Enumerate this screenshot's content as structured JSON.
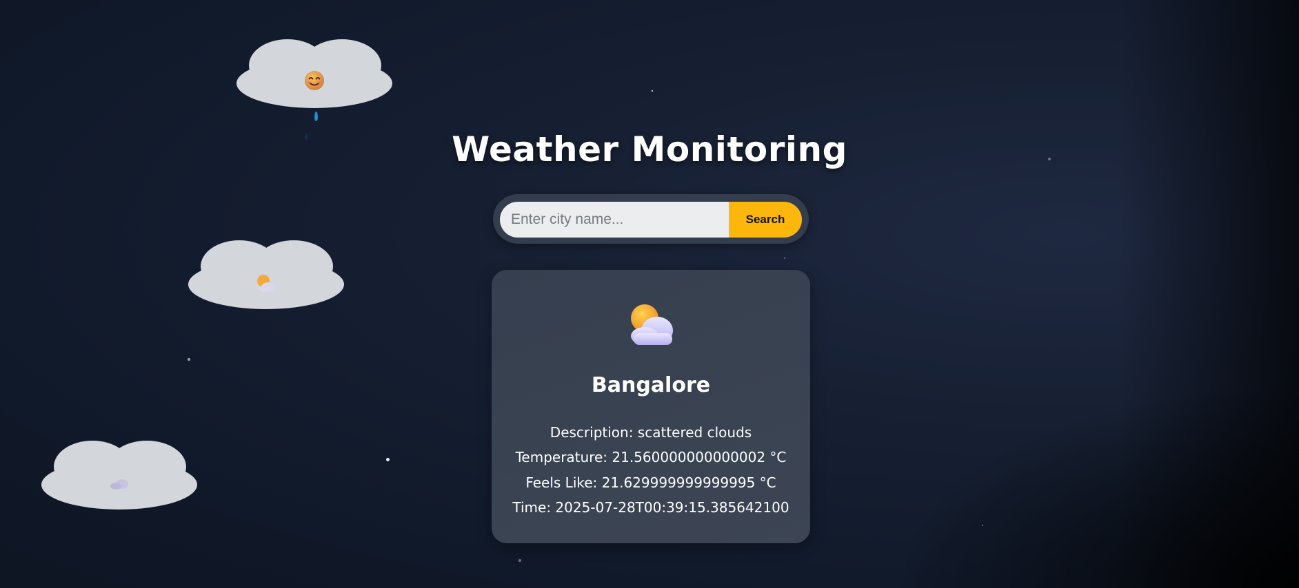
{
  "page": {
    "title": "Weather Monitoring"
  },
  "search": {
    "placeholder": "Enter city name...",
    "value": "",
    "button_label": "Search"
  },
  "weather": {
    "icon": "sun-behind-cloud-icon",
    "city": "Bangalore",
    "description": "Description: scattered clouds",
    "temperature": "Temperature: 21.560000000000002 °C",
    "feels_like": "Feels Like: 21.629999999999995 °C",
    "time": "Time: 2025-07-28T00:39:15.385642100"
  },
  "decor": {
    "clouds": [
      {
        "name": "cloud-smiling-face",
        "icon": "smiling-face-icon",
        "glyph": "😊"
      },
      {
        "name": "cloud-sun-cloud",
        "icon": "sun-behind-cloud-icon",
        "glyph": "⛅"
      },
      {
        "name": "cloud-cloud",
        "icon": "cloud-icon",
        "glyph": "☁"
      }
    ]
  },
  "colors": {
    "background": "#141d2e",
    "card": "#394252",
    "accent": "#fdb60c",
    "cloud": "#d3d6da",
    "raindrop": "#1d8fd8"
  }
}
